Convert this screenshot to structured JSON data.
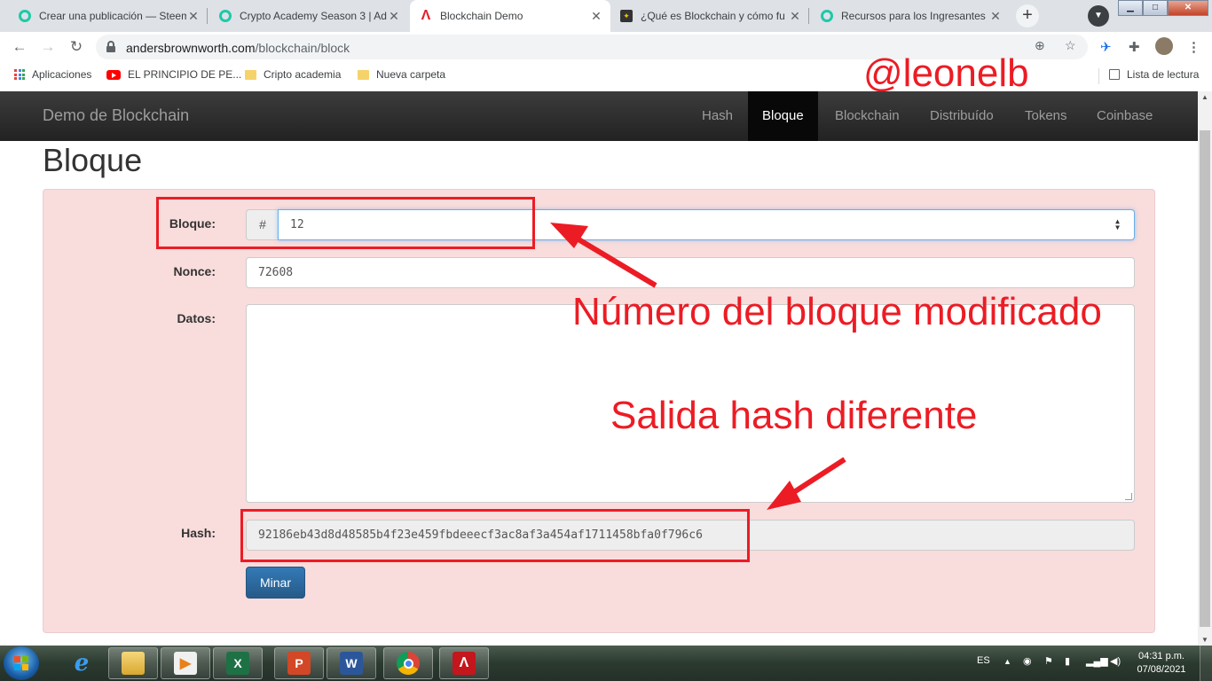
{
  "browser": {
    "tabs": [
      {
        "title": "Crear una publicación — Steem",
        "icon": "steem-icon"
      },
      {
        "title": "Crypto Academy Season 3 | Ad",
        "icon": "steem-icon"
      },
      {
        "title": "Blockchain Demo",
        "icon": "blockchain-demo-icon",
        "active": true
      },
      {
        "title": "¿Qué es Blockchain y cómo fu",
        "icon": "article-icon"
      },
      {
        "title": "Recursos para los Ingresantes",
        "icon": "steem-icon"
      }
    ],
    "new_tab": "+",
    "url_host": "andersbrownworth.com",
    "url_path": "/blockchain/block",
    "bookmarks": [
      {
        "label": "Aplicaciones",
        "icon": "apps-grid-icon"
      },
      {
        "label": "EL PRINCIPIO DE PE...",
        "icon": "youtube-icon"
      },
      {
        "label": "Cripto academia",
        "icon": "folder-icon"
      },
      {
        "label": "Nueva carpeta",
        "icon": "folder-icon"
      }
    ],
    "reading_list": "Lista de lectura"
  },
  "site": {
    "brand": "Demo de Blockchain",
    "nav": [
      "Hash",
      "Bloque",
      "Blockchain",
      "Distribuído",
      "Tokens",
      "Coinbase"
    ],
    "active_nav": "Bloque"
  },
  "page": {
    "title": "Bloque",
    "block_label": "Bloque:",
    "block_prefix": "#",
    "block_value": "12",
    "nonce_label": "Nonce:",
    "nonce_value": "72608",
    "data_label": "Datos:",
    "data_value": "",
    "hash_label": "Hash:",
    "hash_value": "92186eb43d8d48585b4f23e459fbdeeecf3ac8af3a454af1711458bfa0f796c6",
    "mine_button": "Minar",
    "panel_color": "#f9dcdc"
  },
  "annotations": {
    "author": "@leonelb",
    "block_note": "Número del bloque modificado",
    "hash_note": "Salida hash diferente",
    "color": "#ec1c24"
  },
  "taskbar": {
    "apps": [
      "internet-explorer-icon",
      "file-explorer-icon",
      "media-player-icon",
      "excel-icon",
      "powerpoint-icon",
      "word-icon",
      "chrome-icon",
      "acrobat-icon"
    ],
    "language": "ES",
    "time": "04:31 p.m.",
    "date": "07/08/2021"
  }
}
